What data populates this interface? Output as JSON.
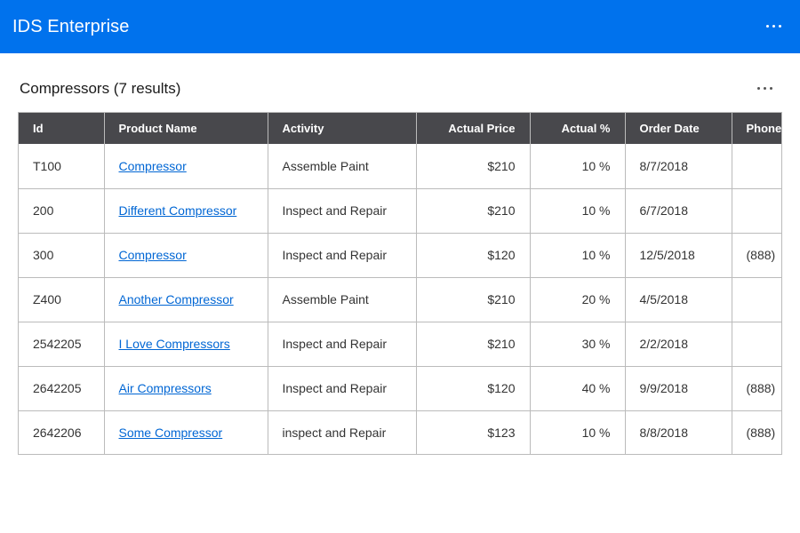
{
  "header": {
    "title": "IDS Enterprise",
    "more_icon": "more-horizontal-icon"
  },
  "card": {
    "title": "Compressors (7 results)",
    "more_icon": "more-horizontal-icon"
  },
  "grid": {
    "columns": [
      "Id",
      "Product Name",
      "Activity",
      "Actual Price",
      "Actual %",
      "Order Date",
      "Phone"
    ],
    "rows": [
      {
        "id": "T100",
        "product": "Compressor",
        "activity": "Assemble Paint",
        "price": "$210",
        "percent": "10 %",
        "date": "8/7/2018",
        "phone": ""
      },
      {
        "id": "200",
        "product": "Different Compressor",
        "activity": "Inspect and Repair",
        "price": "$210",
        "percent": "10 %",
        "date": "6/7/2018",
        "phone": ""
      },
      {
        "id": "300",
        "product": "Compressor",
        "activity": "Inspect and Repair",
        "price": "$120",
        "percent": "10 %",
        "date": "12/5/2018",
        "phone": "(888)"
      },
      {
        "id": "Z400",
        "product": "Another Compressor",
        "activity": "Assemble Paint",
        "price": "$210",
        "percent": "20 %",
        "date": "4/5/2018",
        "phone": ""
      },
      {
        "id": "2542205",
        "product": "I Love Compressors",
        "activity": "Inspect and Repair",
        "price": "$210",
        "percent": "30 %",
        "date": "2/2/2018",
        "phone": ""
      },
      {
        "id": "2642205",
        "product": "Air Compressors",
        "activity": "Inspect and Repair",
        "price": "$120",
        "percent": "40 %",
        "date": "9/9/2018",
        "phone": "(888)"
      },
      {
        "id": "2642206",
        "product": "Some Compressor",
        "activity": "inspect and Repair",
        "price": "$123",
        "percent": "10 %",
        "date": "8/8/2018",
        "phone": "(888)"
      }
    ]
  },
  "colors": {
    "header_bg": "#0072ed",
    "grid_header_bg": "#48484c",
    "link": "#0066d4",
    "border": "#bbbbbb"
  }
}
